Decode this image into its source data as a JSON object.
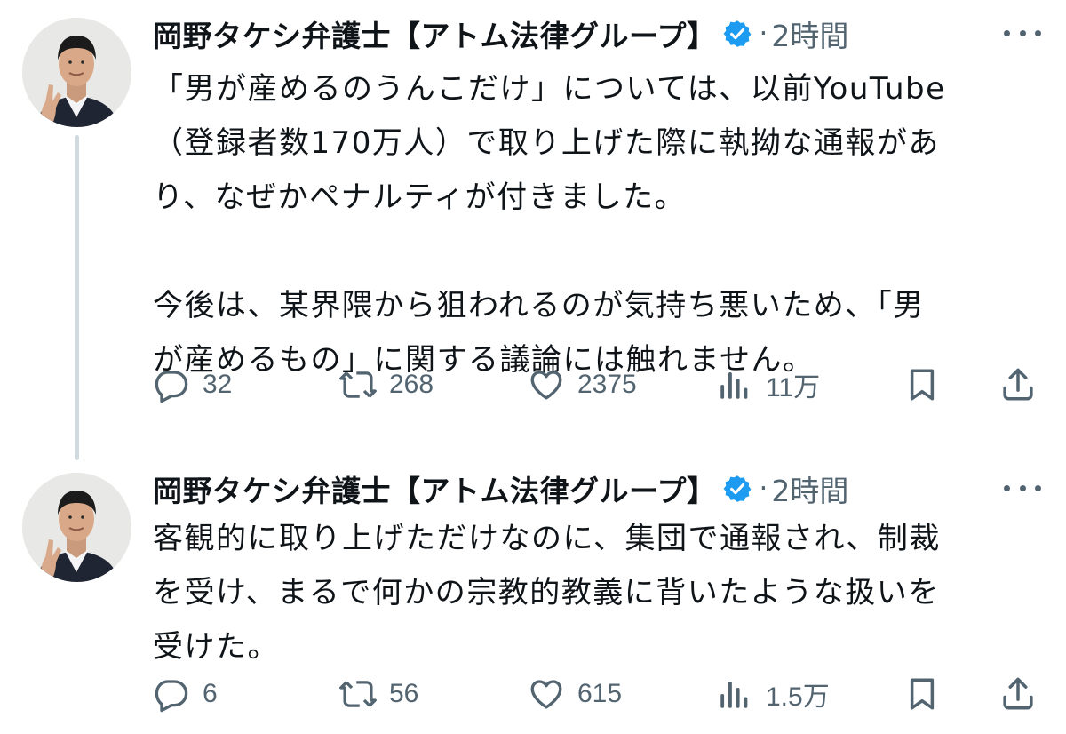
{
  "tweets": [
    {
      "author_name": "岡野タケシ弁護士【アトム法律グループ】",
      "separator": "·",
      "time": "2時間",
      "body": "「男が産めるのうんこだけ」については、以前YouTube\n（登録者数170万人）で取り上げた際に執拗な通報があ\nり、なぜかペナルティが付きました。\n\n今後は、某界隈から狙われるのが気持ち悪いため、「男\nが産めるもの」に関する議論には触れません。",
      "replies": "32",
      "reposts": "268",
      "likes": "2375",
      "views": "11万"
    },
    {
      "author_name": "岡野タケシ弁護士【アトム法律グループ】",
      "separator": "·",
      "time": "2時間",
      "body": "客観的に取り上げただけなのに、集団で通報され、制裁\nを受け、まるで何かの宗教的教義に背いたような扱いを\n受けた。",
      "replies": "6",
      "reposts": "56",
      "likes": "615",
      "views": "1.5万"
    }
  ],
  "icons": {
    "verified": "verified-badge-icon",
    "more": "more-options-icon",
    "reply": "reply-icon",
    "repost": "repost-icon",
    "like": "heart-icon",
    "views": "views-icon",
    "bookmark": "bookmark-icon",
    "share": "share-icon"
  },
  "colors": {
    "verified_badge": "#1d9bf0",
    "secondary_text": "#536471",
    "primary_text": "#0f1419",
    "thread_line": "#cfd9de"
  }
}
